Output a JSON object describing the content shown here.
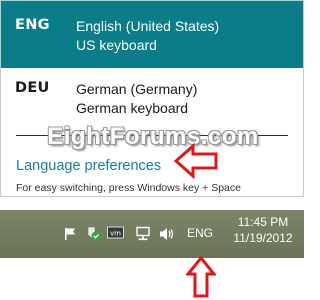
{
  "flyout": {
    "languages": [
      {
        "code": "ENG",
        "name": "English (United States)",
        "keyboard": "US keyboard",
        "selected": true
      },
      {
        "code": "DEU",
        "name": "German (Germany)",
        "keyboard": "German keyboard",
        "selected": false
      }
    ],
    "preferences_link": "Language preferences",
    "hint": "For easy switching, press Windows key + Space"
  },
  "watermark": "EightForums.com",
  "taskbar": {
    "tray_icons": [
      "flag-icon",
      "shield-check-icon",
      "vm-icon",
      "network-icon",
      "speaker-icon"
    ],
    "language_indicator": "ENG",
    "clock": {
      "time": "11:45 PM",
      "date": "11/19/2012"
    }
  },
  "colors": {
    "selected_row": "#0b7d88",
    "link": "#1a7ca8",
    "taskbar": "#6f7a5e",
    "annotation_arrow": "#e0161b"
  }
}
